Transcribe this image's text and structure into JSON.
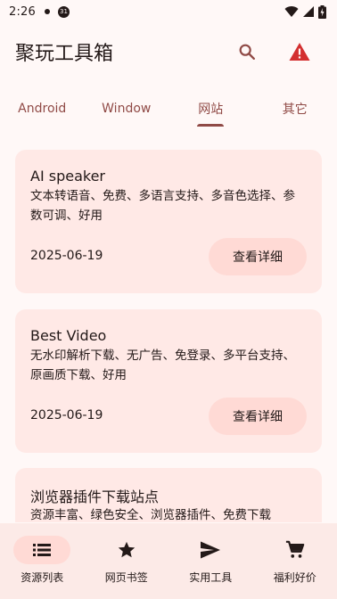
{
  "status_bar": {
    "time": "2:26",
    "notification_count": "31"
  },
  "app": {
    "title": "聚玩工具箱"
  },
  "tabs": [
    {
      "label": "Android",
      "active": false
    },
    {
      "label": "Window",
      "active": false
    },
    {
      "label": "网站",
      "active": true
    },
    {
      "label": "其它",
      "active": false
    }
  ],
  "cards": [
    {
      "title": "AI speaker",
      "description": "文本转语音、免费、多语言支持、多音色选择、参数可调、好用",
      "date": "2025-06-19",
      "button_label": "查看详细"
    },
    {
      "title": "Best Video",
      "description": "无水印解析下载、无广告、免登录、多平台支持、原画质下载、好用",
      "date": "2025-06-19",
      "button_label": "查看详细"
    },
    {
      "title": "浏览器插件下载站点",
      "description": "资源丰富、绿色安全、浏览器插件、免费下载"
    }
  ],
  "bottom_nav": [
    {
      "label": "资源列表",
      "icon": "list-icon",
      "active": true
    },
    {
      "label": "网页书签",
      "icon": "star-icon",
      "active": false
    },
    {
      "label": "实用工具",
      "icon": "send-icon",
      "active": false
    },
    {
      "label": "福利好价",
      "icon": "cart-icon",
      "active": false
    }
  ],
  "colors": {
    "background": "#fff8f7",
    "primary": "#904a46",
    "card": "#ffe9e6",
    "button": "#ffdad5",
    "warning": "#d32f2f"
  }
}
